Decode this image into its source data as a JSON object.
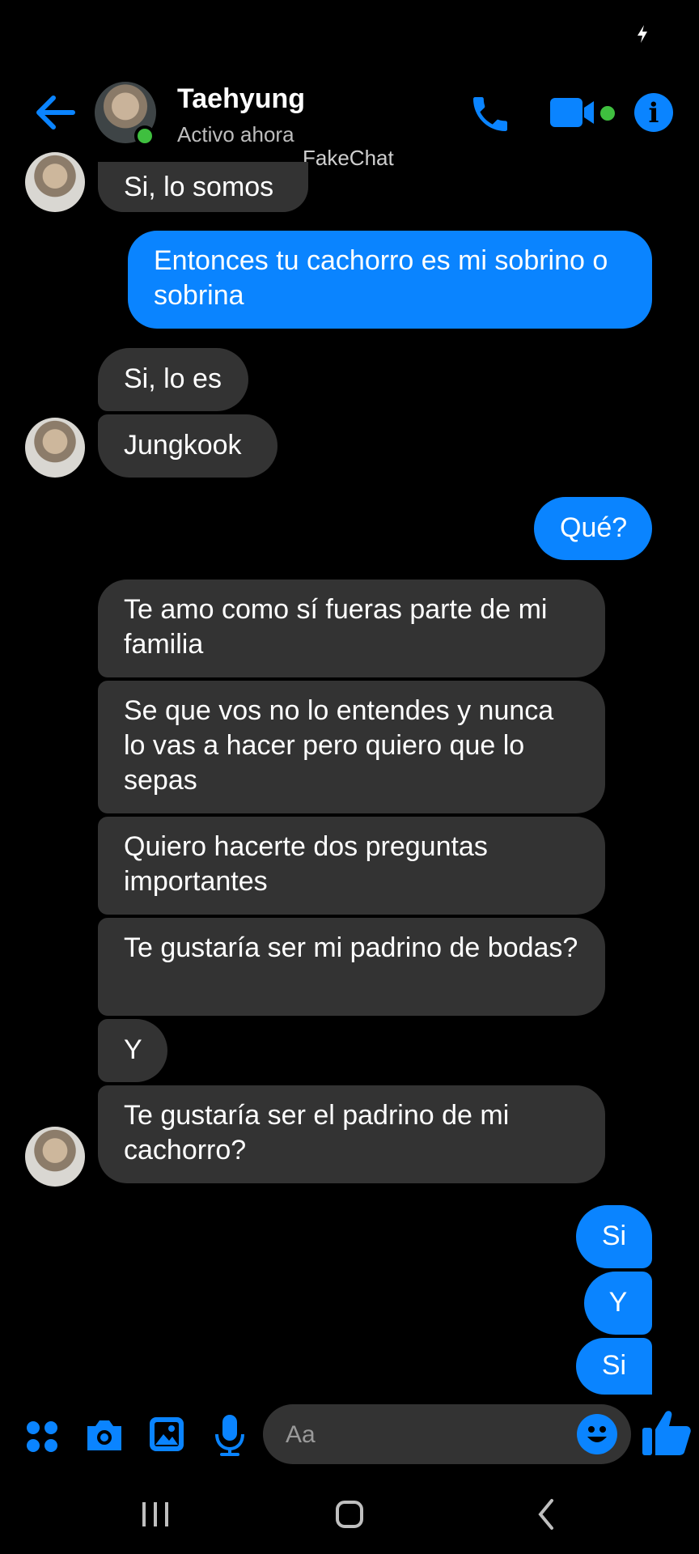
{
  "colors": {
    "accent": "#0a84ff",
    "incoming_bubble": "#333333",
    "online": "#3fbf3f"
  },
  "header": {
    "name": "Taehyung",
    "status": "Activo ahora",
    "watermark": "FakeChat",
    "icons": [
      "back-arrow-icon",
      "phone-icon",
      "video-camera-icon",
      "info-icon"
    ]
  },
  "messages": [
    {
      "dir": "in",
      "text": "Si, lo somos"
    },
    {
      "dir": "out",
      "text": "Entonces tu cachorro es mi sobrino o sobrina"
    },
    {
      "dir": "in",
      "text": "Si, lo es"
    },
    {
      "dir": "in",
      "text": "Jungkook"
    },
    {
      "dir": "out",
      "text": "Qué?"
    },
    {
      "dir": "in",
      "text": "Te amo como sí fueras parte de mi familia"
    },
    {
      "dir": "in",
      "text": "Se que vos no lo entendes y nunca lo vas a hacer pero quiero que lo sepas"
    },
    {
      "dir": "in",
      "text": "Quiero hacerte dos preguntas importantes"
    },
    {
      "dir": "in",
      "text": "Te gustaría ser mi padrino de bodas?"
    },
    {
      "dir": "in",
      "text": "Y"
    },
    {
      "dir": "in",
      "text": "Te gustaría ser el padrino de mi cachorro?"
    },
    {
      "dir": "out",
      "text": "Si"
    },
    {
      "dir": "out",
      "text": "Y"
    },
    {
      "dir": "out",
      "text": "Si"
    }
  ],
  "composer": {
    "placeholder": "Aa",
    "icons": [
      "apps-icon",
      "camera-icon",
      "gallery-icon",
      "microphone-icon",
      "emoji-icon",
      "thumbs-up-icon"
    ]
  },
  "nav": {
    "icons": [
      "recent-apps-icon",
      "home-icon",
      "back-icon"
    ]
  }
}
